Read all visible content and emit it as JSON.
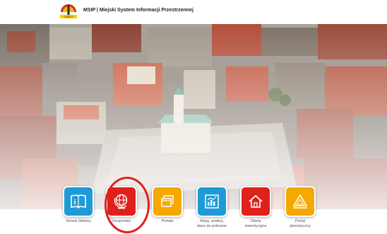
{
  "header": {
    "title": "MSIP | Miejski System Informacji Przestrzennej",
    "logo_text": "GLIWICE"
  },
  "tiles": [
    {
      "label": "Serwis Główny",
      "color": "#1e9ad6",
      "icon": "book-info-icon"
    },
    {
      "label": "Geoportale",
      "color": "#e0201c",
      "icon": "globe-icon"
    },
    {
      "label": "Portale",
      "color": "#f5a800",
      "icon": "windows-icon"
    },
    {
      "label": "Mapy, analizy,\ndane do pobrania",
      "color": "#1e9ad6",
      "icon": "chart-icon"
    },
    {
      "label": "Oferta\ninwestycyjna",
      "color": "#e0201c",
      "icon": "home-icon"
    },
    {
      "label": "Portal\nplanistyczny",
      "color": "#f5a800",
      "icon": "ruler-triangle-icon"
    }
  ]
}
